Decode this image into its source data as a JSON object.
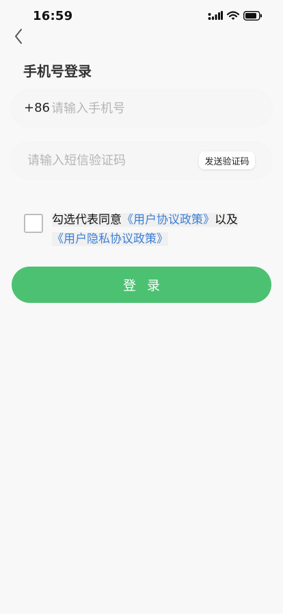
{
  "status_bar": {
    "time": "16:59",
    "signal_icon": "signal-icon",
    "wifi_icon": "wifi-icon",
    "battery_icon": "battery-icon"
  },
  "nav": {
    "back_icon": "chevron-left-icon"
  },
  "page": {
    "title": "手机号登录"
  },
  "phone": {
    "country_code": "+86",
    "placeholder": "请输入手机号",
    "value": ""
  },
  "code": {
    "placeholder": "请输入短信验证码",
    "value": "",
    "send_button_label": "发送验证码"
  },
  "agreement": {
    "checked": false,
    "prefix": "勾选代表同意",
    "user_agreement_link": "《用户协议政策》",
    "connector": "以及",
    "privacy_link": "《用户隐私协议政策》"
  },
  "login": {
    "button_label": "登录"
  },
  "colors": {
    "accent": "#4cc172",
    "link": "#3d7fd6",
    "background": "#f8f8f8"
  }
}
